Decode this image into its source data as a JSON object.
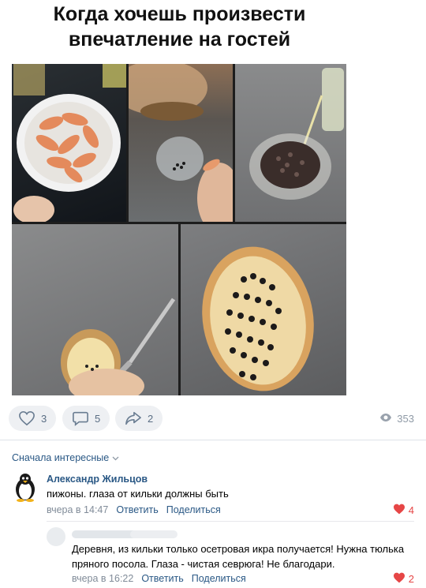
{
  "post": {
    "title_line1": "Когда хочешь произвести",
    "title_line2": "впечатление на гостей"
  },
  "actions": {
    "likes": "3",
    "comments": "5",
    "shares": "2",
    "views": "353"
  },
  "comments_sort": "Сначала интересные",
  "comments": [
    {
      "author": "Александр Жильцов",
      "text": "пижоны. глаза от кильки должны быть",
      "time": "вчера в 14:47",
      "reply_label": "Ответить",
      "share_label": "Поделиться",
      "likes": "4"
    }
  ],
  "reply": {
    "text": "Деревня, из кильки только осетровая икра получается! Нужна тюлька пряного посола. Глаза - чистая севрюга! Не благодари.",
    "time": "вчера в 16:22",
    "reply_label": "Ответить",
    "share_label": "Поделиться",
    "likes": "2"
  },
  "colors": {
    "link": "#2a5885",
    "muted": "#818c99",
    "like_red": "#e64646",
    "pill_bg": "#eef0f3"
  }
}
